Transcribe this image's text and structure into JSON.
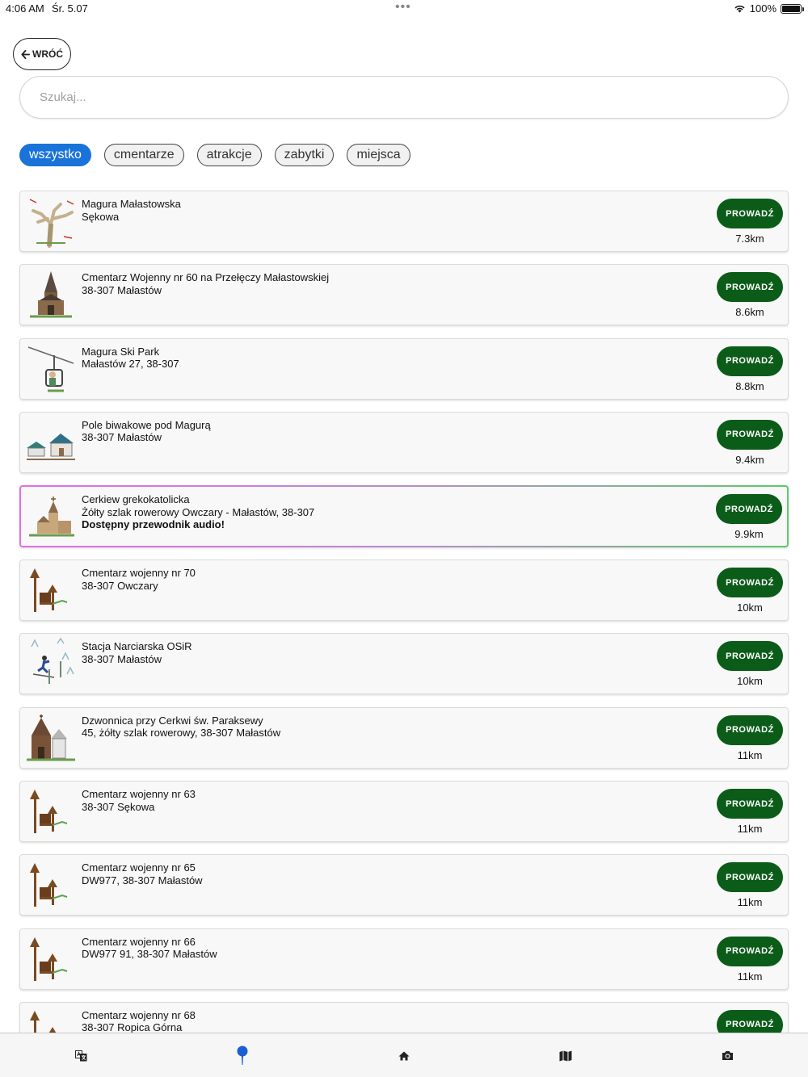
{
  "status_bar": {
    "time": "4:06 AM",
    "date": "Śr. 5.07",
    "dots": "•••",
    "battery_percent": "100%"
  },
  "back_button": {
    "label": "WRÓĆ"
  },
  "search": {
    "placeholder": "Szukaj..."
  },
  "filters": [
    {
      "label": "wszystko",
      "active": true
    },
    {
      "label": "cmentarze",
      "active": false
    },
    {
      "label": "atrakcje",
      "active": false
    },
    {
      "label": "zabytki",
      "active": false
    },
    {
      "label": "miejsca",
      "active": false
    }
  ],
  "places": [
    {
      "name": "Magura Małastowska",
      "address": "Sękowa",
      "extra": "",
      "button": "PROWADŹ",
      "distance": "7.3km",
      "icon": "tree-icon"
    },
    {
      "name": "Cmentarz Wojenny nr 60 na Przełęczy Małastowskiej",
      "address": "38-307 Małastów",
      "extra": "",
      "button": "PROWADŹ",
      "distance": "8.6km",
      "icon": "chapel-icon"
    },
    {
      "name": "Magura Ski Park",
      "address": "Małastów 27, 38-307",
      "extra": "",
      "button": "PROWADŹ",
      "distance": "8.8km",
      "icon": "chairlift-icon"
    },
    {
      "name": "Pole biwakowe pod Magurą",
      "address": "38-307 Małastów",
      "extra": "",
      "button": "PROWADŹ",
      "distance": "9.4km",
      "icon": "campsite-icon"
    },
    {
      "name": "Cerkiew grekokatolicka",
      "address": "Żółty szlak rowerowy Owczary - Małastów, 38-307",
      "extra": "Dostępny przewodnik audio!",
      "button": "PROWADŹ",
      "distance": "9.9km",
      "icon": "church-icon"
    },
    {
      "name": "Cmentarz wojenny nr 70",
      "address": "38-307 Owczary",
      "extra": "",
      "button": "PROWADŹ",
      "distance": "10km",
      "icon": "cemetery-icon"
    },
    {
      "name": "Stacja Narciarska OSiR",
      "address": "38-307 Małastów",
      "extra": "",
      "button": "PROWADŹ",
      "distance": "10km",
      "icon": "skier-icon"
    },
    {
      "name": "Dzwonnica przy Cerkwi św. Paraksewy",
      "address": "45, żółty szlak rowerowy, 38-307 Małastów",
      "extra": "",
      "button": "PROWADŹ",
      "distance": "11km",
      "icon": "belfry-icon"
    },
    {
      "name": "Cmentarz wojenny nr 63",
      "address": "38-307 Sękowa",
      "extra": "",
      "button": "PROWADŹ",
      "distance": "11km",
      "icon": "cemetery-icon"
    },
    {
      "name": "Cmentarz wojenny nr 65",
      "address": "DW977, 38-307 Małastów",
      "extra": "",
      "button": "PROWADŹ",
      "distance": "11km",
      "icon": "cemetery-icon"
    },
    {
      "name": "Cmentarz wojenny nr 66",
      "address": "DW977 91, 38-307 Małastów",
      "extra": "",
      "button": "PROWADŹ",
      "distance": "11km",
      "icon": "cemetery-icon"
    },
    {
      "name": "Cmentarz wojenny nr 68",
      "address": "38-307 Ropica Górna",
      "extra": "",
      "button": "PROWADŹ",
      "distance": "",
      "icon": "cemetery-icon"
    }
  ],
  "tabbar": [
    {
      "icon": "translate-icon"
    },
    {
      "icon": "map-pin-icon",
      "active": true
    },
    {
      "icon": "home-icon"
    },
    {
      "icon": "map-icon"
    },
    {
      "icon": "camera-icon"
    }
  ],
  "colors": {
    "accent": "#1a73d9",
    "button_green": "#0b5c18"
  }
}
